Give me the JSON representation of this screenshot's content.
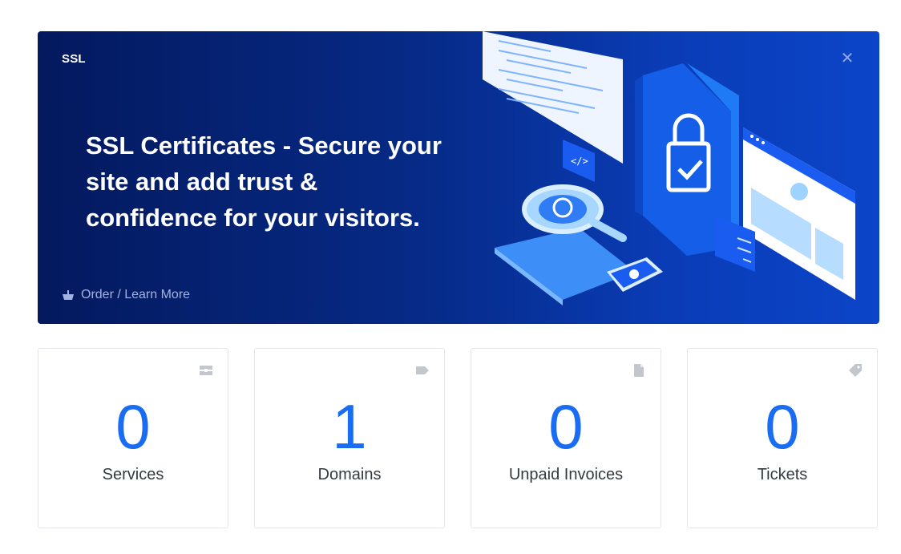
{
  "banner": {
    "tag": "SSL",
    "title": "SSL Certificates - Secure your site and add trust & confidence for your visitors.",
    "link_label": "Order / Learn More",
    "close_icon": "close-icon"
  },
  "stats": [
    {
      "value": "0",
      "label": "Services",
      "icon": "server-icon"
    },
    {
      "value": "1",
      "label": "Domains",
      "icon": "tag-icon"
    },
    {
      "value": "0",
      "label": "Unpaid Invoices",
      "icon": "document-icon"
    },
    {
      "value": "0",
      "label": "Tickets",
      "icon": "ticket-icon"
    }
  ],
  "colors": {
    "banner_dark": "#04195e",
    "banner_light": "#0b45c8",
    "stat_value": "#1a6cf2",
    "stat_label": "#333a42"
  }
}
